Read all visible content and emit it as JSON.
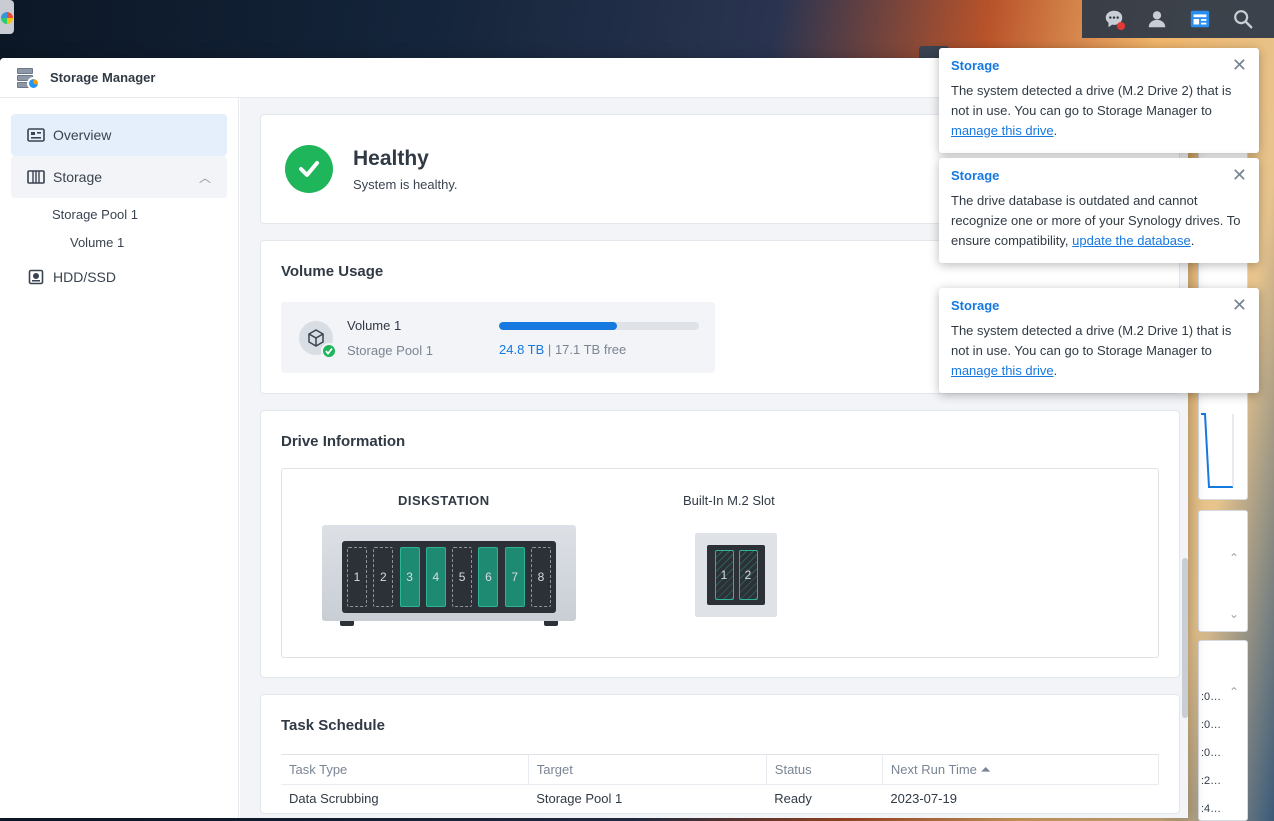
{
  "window": {
    "title": "Storage Manager"
  },
  "sidebar": {
    "items": [
      {
        "label": "Overview"
      },
      {
        "label": "Storage"
      },
      {
        "label": "Storage Pool 1"
      },
      {
        "label": "Volume 1"
      },
      {
        "label": "HDD/SSD"
      }
    ]
  },
  "health": {
    "title": "Healthy",
    "subtitle": "System is healthy."
  },
  "volume_usage": {
    "title": "Volume Usage",
    "volume_name": "Volume 1",
    "pool_name": "Storage Pool 1",
    "used": "24.8 TB",
    "separator": "|",
    "free": "17.1 TB free",
    "used_fraction": 0.59
  },
  "drive_info": {
    "title": "Drive Information",
    "diskstation_label": "DISKSTATION",
    "m2_label": "Built-In M.2 Slot",
    "bays": [
      {
        "num": "1",
        "filled": false
      },
      {
        "num": "2",
        "filled": false
      },
      {
        "num": "3",
        "filled": true
      },
      {
        "num": "4",
        "filled": true
      },
      {
        "num": "5",
        "filled": false
      },
      {
        "num": "6",
        "filled": true
      },
      {
        "num": "7",
        "filled": true
      },
      {
        "num": "8",
        "filled": false
      }
    ],
    "m2_slots": [
      "1",
      "2"
    ]
  },
  "task_schedule": {
    "title": "Task Schedule",
    "columns": [
      "Task Type",
      "Target",
      "Status",
      "Next Run Time ⏶"
    ],
    "rows": [
      [
        "Data Scrubbing",
        "Storage Pool 1",
        "Ready",
        "2023-07-19"
      ]
    ]
  },
  "notifications": [
    {
      "title": "Storage",
      "text_before": "The system detected a drive (M.2 Drive 2) that is not in use. You can go to Storage Manager to ",
      "link": "manage this drive",
      "text_after": "."
    },
    {
      "title": "Storage",
      "text_before": "The drive database is outdated and cannot recognize one or more of your Synology drives. To ensure compatibility, ",
      "link": "update the database",
      "text_after": "."
    },
    {
      "title": "Storage",
      "text_before": "The system detected a drive (M.2 Drive 1) that is not in use. You can go to Storage Manager to ",
      "link": "manage this drive",
      "text_after": "."
    }
  ],
  "colors": {
    "accent": "#1679e0",
    "healthy": "#1fb55b",
    "drive_filled": "#1f8a72"
  }
}
